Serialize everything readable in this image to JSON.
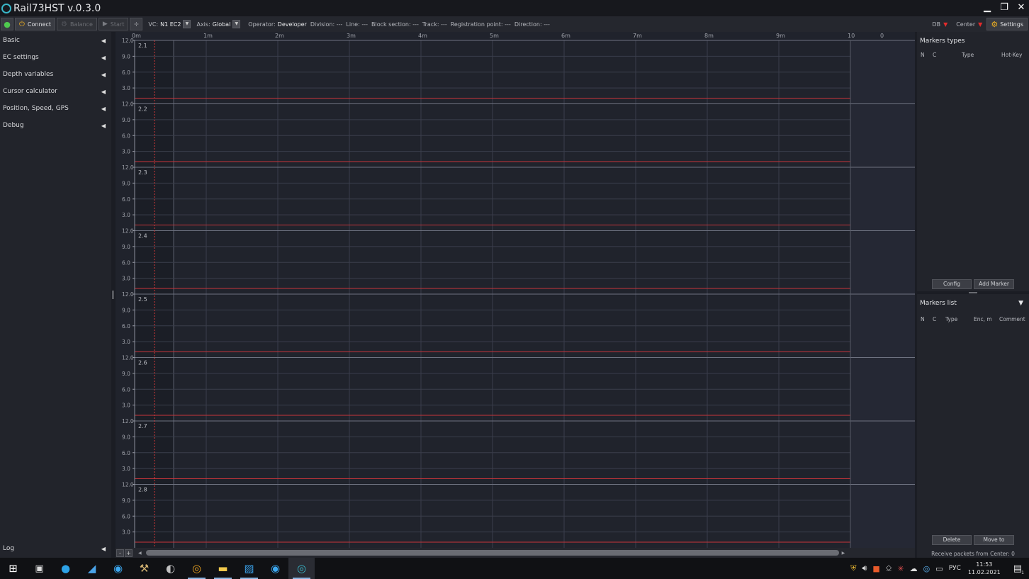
{
  "window": {
    "title": "Rail73HST v.0.3.0",
    "minimize": "▁",
    "maximize": "❐",
    "close": "✕"
  },
  "toolbar": {
    "connect": "Connect",
    "balance": "Balance",
    "start": "Start",
    "vc_label": "VC:",
    "vc_value": "N1 EC2",
    "axis_label": "Axis:",
    "axis_value": "Global",
    "operator_label": "Operator:",
    "operator_value": "Developer",
    "division": "Division: ---",
    "line": "Line: ---",
    "block_section": "Block section: ---",
    "track": "Track: ---",
    "registration_point": "Registration point: ---",
    "direction": "Direction: ---",
    "db_label": "DB",
    "center_label": "Center",
    "settings": "Settings"
  },
  "left_panel": {
    "items": [
      {
        "label": "Basic"
      },
      {
        "label": "EC settings"
      },
      {
        "label": "Depth variables"
      },
      {
        "label": "Cursor calculator"
      },
      {
        "label": "Position, Speed, GPS"
      },
      {
        "label": "Debug"
      }
    ],
    "log": "Log"
  },
  "chart": {
    "x_ticks": [
      "0m",
      "1m",
      "2m",
      "3m",
      "4m",
      "5m",
      "6m",
      "7m",
      "8m",
      "9m",
      "10"
    ],
    "x_extra": "0",
    "channels": [
      "2.1",
      "2.2",
      "2.3",
      "2.4",
      "2.5",
      "2.6",
      "2.7",
      "2.8"
    ],
    "y_ticks": [
      "12.0",
      "9.0",
      "6.0",
      "3.0"
    ],
    "grid_color": "#3a3e4b",
    "threshold_color": "#c8343a",
    "cursor_color": "#d03838"
  },
  "scrollbar": {
    "minus": "-",
    "plus": "+"
  },
  "right_panel": {
    "markers_types": {
      "title": "Markers types",
      "headers": [
        "N",
        "C",
        "Type",
        "Hot-Key"
      ],
      "config": "Config",
      "add_marker": "Add Marker"
    },
    "markers_list": {
      "title": "Markers list",
      "headers": [
        "N",
        "C",
        "Type",
        "Enc, m",
        "Comment"
      ],
      "delete": "Delete",
      "move_to": "Move to"
    },
    "status": "Receive packets from Center: 0"
  },
  "taskbar": {
    "lang": "РУС",
    "time": "11:53",
    "date": "11.02.2021",
    "notifications": "1"
  }
}
